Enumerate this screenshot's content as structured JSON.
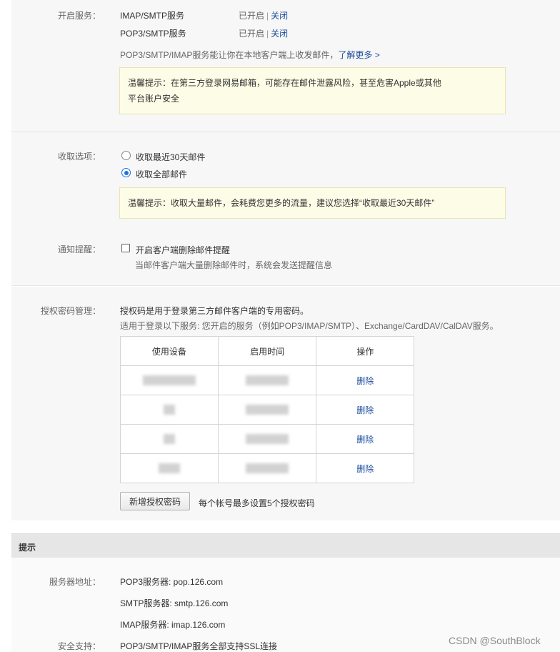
{
  "service": {
    "label": "开启服务：",
    "rows": [
      {
        "name": "IMAP/SMTP服务",
        "status": "已开启",
        "sep": "|",
        "action": "关闭"
      },
      {
        "name": "POP3/SMTP服务",
        "status": "已开启",
        "sep": "|",
        "action": "关闭"
      }
    ],
    "desc": "POP3/SMTP/IMAP服务能让你在本地客户端上收发邮件，",
    "learn_more": "了解更多 >",
    "tip_line1": "温馨提示：在第三方登录网易邮箱，可能存在邮件泄露风险，甚至危害Apple或其他",
    "tip_line2": "平台账户安全"
  },
  "receive": {
    "label": "收取选项：",
    "options": [
      {
        "label": "收取最近30天邮件",
        "checked": false
      },
      {
        "label": "收取全部邮件",
        "checked": true
      }
    ],
    "tip": "温馨提示：收取大量邮件，会耗费您更多的流量，建议您选择“收取最近30天邮件”"
  },
  "notify": {
    "label": "通知提醒：",
    "checkbox_label": "开启客户端删除邮件提醒",
    "checked": false,
    "sub": "当邮件客户端大量删除邮件时，系统会发送提醒信息"
  },
  "auth": {
    "label": "授权密码管理：",
    "desc1": "授权码是用于登录第三方邮件客户端的专用密码。",
    "desc2": "适用于登录以下服务: 您开启的服务（例如POP3/IMAP/SMTP）、Exchange/CardDAV/CalDAV服务。",
    "headers": [
      "使用设备",
      "启用时间",
      "操作"
    ],
    "rows": [
      {
        "action": "删除"
      },
      {
        "action": "删除"
      },
      {
        "action": "删除"
      },
      {
        "action": "删除"
      }
    ],
    "add_button": "新增授权密码",
    "limit_note": "每个帐号最多设置5个授权密码"
  },
  "hint": {
    "title": "提示",
    "server_label": "服务器地址：",
    "servers": [
      "POP3服务器: pop.126.com",
      "SMTP服务器: smtp.126.com",
      "IMAP服务器: imap.126.com"
    ],
    "ssl_label": "安全支持：",
    "ssl_text": "POP3/SMTP/IMAP服务全部支持SSL连接"
  },
  "watermark": "CSDN @SouthBlock",
  "colors": {
    "link": "#1a4c9c",
    "radio_on": "#1a73e8",
    "tip_bg": "#fdfce6"
  }
}
